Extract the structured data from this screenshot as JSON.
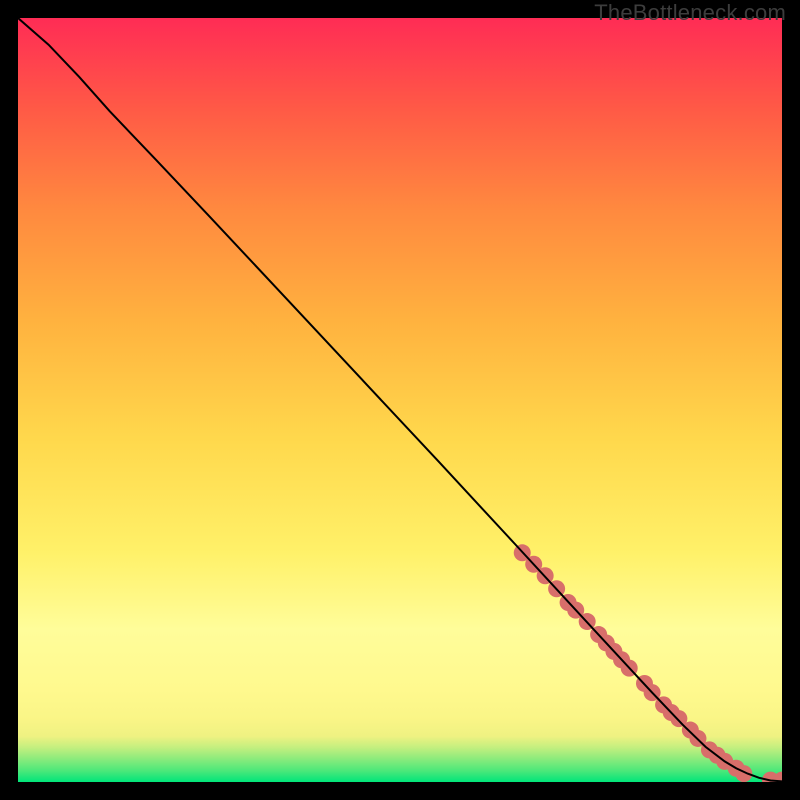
{
  "watermark": "TheBottleneck.com",
  "chart_data": {
    "type": "line",
    "title": "",
    "xlabel": "",
    "ylabel": "",
    "xlim": [
      0,
      100
    ],
    "ylim": [
      0,
      100
    ],
    "grid": false,
    "legend": false,
    "background_gradient": {
      "stops": [
        {
          "offset": 0.0,
          "color": "#00e57a"
        },
        {
          "offset": 0.015,
          "color": "#4de87a"
        },
        {
          "offset": 0.03,
          "color": "#8aeb7c"
        },
        {
          "offset": 0.045,
          "color": "#c3ef7f"
        },
        {
          "offset": 0.06,
          "color": "#eff282"
        },
        {
          "offset": 0.08,
          "color": "#f9f586"
        },
        {
          "offset": 0.12,
          "color": "#fff98e"
        },
        {
          "offset": 0.2,
          "color": "#fffd9a"
        },
        {
          "offset": 0.3,
          "color": "#fff169"
        },
        {
          "offset": 0.45,
          "color": "#ffd84c"
        },
        {
          "offset": 0.6,
          "color": "#ffb33f"
        },
        {
          "offset": 0.75,
          "color": "#ff893f"
        },
        {
          "offset": 0.88,
          "color": "#ff5a46"
        },
        {
          "offset": 1.0,
          "color": "#ff2c55"
        }
      ]
    },
    "series": [
      {
        "name": "curve",
        "type": "line",
        "color": "#000000",
        "x": [
          0,
          4,
          8,
          12,
          18,
          25,
          35,
          45,
          55,
          65,
          72,
          78,
          83,
          87,
          90,
          92.5,
          94,
          95.5,
          97,
          98.5,
          100
        ],
        "y": [
          100,
          96.5,
          92.3,
          87.8,
          81.5,
          74.1,
          63.4,
          52.7,
          42.0,
          31.2,
          23.6,
          17.1,
          11.7,
          7.5,
          4.6,
          2.7,
          1.8,
          1.1,
          0.55,
          0.2,
          0.08
        ]
      },
      {
        "name": "markers",
        "type": "scatter",
        "color": "#d86e6a",
        "radius": 8.5,
        "x": [
          66,
          67.5,
          69,
          70.5,
          72,
          73,
          74.5,
          76,
          77,
          78,
          79,
          80,
          82,
          83,
          84.5,
          85.5,
          86.5,
          88,
          89,
          90.5,
          91.5,
          92.5,
          94,
          95,
          98.5,
          100
        ],
        "y": [
          30.0,
          28.5,
          27.0,
          25.3,
          23.5,
          22.5,
          21.0,
          19.3,
          18.2,
          17.1,
          16.0,
          14.9,
          12.9,
          11.7,
          10.1,
          9.1,
          8.3,
          6.8,
          5.7,
          4.2,
          3.5,
          2.7,
          1.8,
          1.1,
          0.25,
          0.25
        ]
      }
    ]
  }
}
